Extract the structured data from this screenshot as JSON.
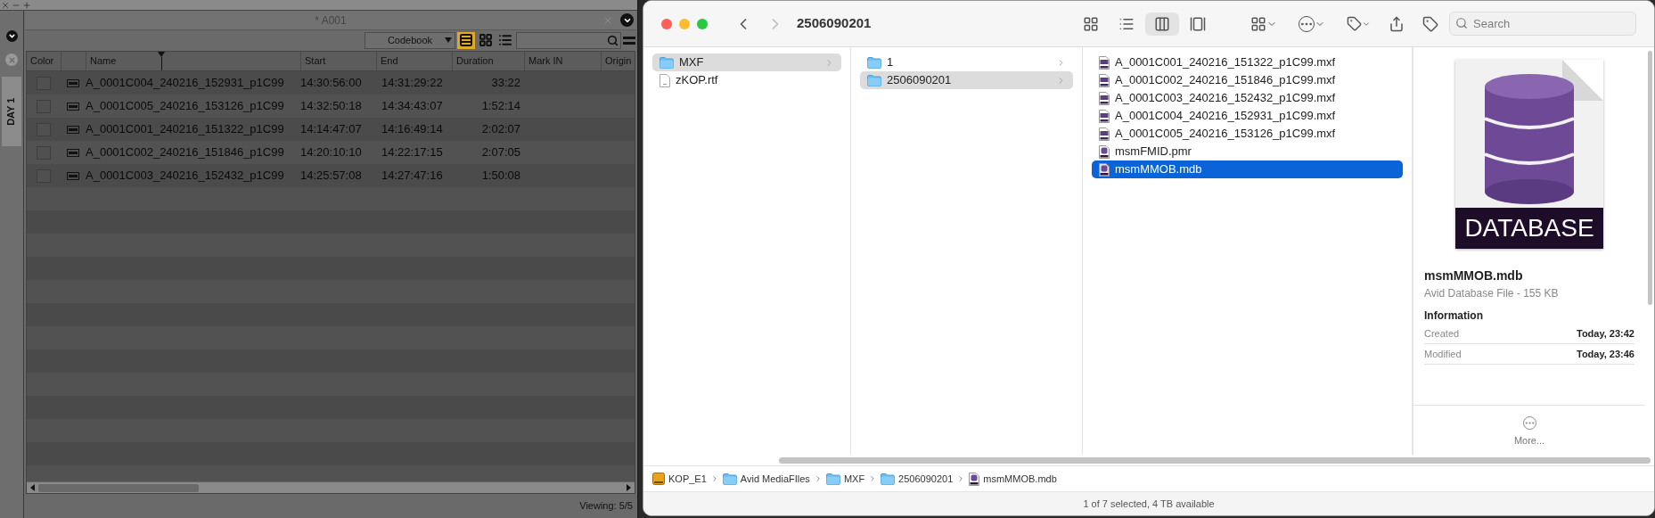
{
  "avid": {
    "title": "* A001",
    "side_tab": "DAY 1",
    "view_menu": "Codebook",
    "views": [
      {
        "kind": "frame",
        "selected": true
      },
      {
        "kind": "grid",
        "selected": false
      },
      {
        "kind": "list",
        "selected": false
      }
    ],
    "columns": [
      {
        "kind": "color",
        "label": "Color"
      },
      {
        "kind": "icon"
      },
      {
        "kind": "text",
        "label": "Name"
      },
      {
        "kind": "text",
        "label": "Start"
      },
      {
        "kind": "text",
        "label": "End"
      },
      {
        "kind": "number",
        "label": "Duration"
      },
      {
        "kind": "text",
        "label": "Mark IN"
      },
      {
        "kind": "text",
        "label": "Origin"
      }
    ],
    "rows": [
      {
        "name": "A_0001C004_240216_152931_p1C99",
        "start": "14:30:56:00",
        "end": "14:31:29:22",
        "duration": "33:22"
      },
      {
        "name": "A_0001C005_240216_153126_p1C99",
        "start": "14:32:50:18",
        "end": "14:34:43:07",
        "duration": "1:52:14"
      },
      {
        "name": "A_0001C001_240216_151322_p1C99",
        "start": "14:14:47:07",
        "end": "14:16:49:14",
        "duration": "2:02:07"
      },
      {
        "name": "A_0001C002_240216_151846_p1C99",
        "start": "14:20:10:10",
        "end": "14:22:17:15",
        "duration": "2:07:05"
      },
      {
        "name": "A_0001C003_240216_152432_p1C99",
        "start": "14:25:57:08",
        "end": "14:27:47:16",
        "duration": "1:50:08"
      }
    ],
    "status": "Viewing: 5/5"
  },
  "finder": {
    "title": "2506090201",
    "search": {
      "placeholder": "Search"
    },
    "view_modes": [
      {
        "kind": "icons",
        "selected": false
      },
      {
        "kind": "list",
        "selected": false
      },
      {
        "kind": "columns",
        "selected": true
      },
      {
        "kind": "gallery",
        "selected": false
      }
    ],
    "columns": [
      {
        "focused": false,
        "items": [
          {
            "name": "MXF",
            "kind": "folder",
            "selected": true,
            "has_children": true
          },
          {
            "name": "zKOP.rtf",
            "kind": "document",
            "selected": false,
            "has_children": false
          }
        ]
      },
      {
        "focused": false,
        "items": [
          {
            "name": "1",
            "kind": "folder",
            "selected": false,
            "has_children": true
          },
          {
            "name": "2506090201",
            "kind": "folder",
            "selected": true,
            "has_children": true
          }
        ]
      },
      {
        "focused": true,
        "items": [
          {
            "name": "A_0001C001_240216_151322_p1C99.mxf",
            "kind": "mxf",
            "selected": false,
            "has_children": false
          },
          {
            "name": "A_0001C002_240216_151846_p1C99.mxf",
            "kind": "mxf",
            "selected": false,
            "has_children": false
          },
          {
            "name": "A_0001C003_240216_152432_p1C99.mxf",
            "kind": "mxf",
            "selected": false,
            "has_children": false
          },
          {
            "name": "A_0001C004_240216_152931_p1C99.mxf",
            "kind": "mxf",
            "selected": false,
            "has_children": false
          },
          {
            "name": "A_0001C005_240216_153126_p1C99.mxf",
            "kind": "mxf",
            "selected": false,
            "has_children": false
          },
          {
            "name": "msmFMID.pmr",
            "kind": "database",
            "selected": false,
            "has_children": false
          },
          {
            "name": "msmMMOB.mdb",
            "kind": "database",
            "selected": true,
            "has_children": false
          }
        ]
      }
    ],
    "preview": {
      "icon_label": "DATABASE",
      "name": "msmMMOB.mdb",
      "kind_size": "Avid Database File - 155 KB",
      "section": "Information",
      "fields": [
        {
          "label": "Created",
          "value": "Today, 23:42"
        },
        {
          "label": "Modified",
          "value": "Today, 23:46"
        }
      ],
      "more": "More..."
    },
    "path": [
      {
        "name": "KOP_E1",
        "kind": "disk"
      },
      {
        "name": "Avid MediaFIles",
        "kind": "folder"
      },
      {
        "name": "MXF",
        "kind": "folder"
      },
      {
        "name": "2506090201",
        "kind": "folder"
      },
      {
        "name": "msmMMOB.mdb",
        "kind": "database"
      }
    ],
    "status": "1 of 7 selected, 4 TB available"
  }
}
